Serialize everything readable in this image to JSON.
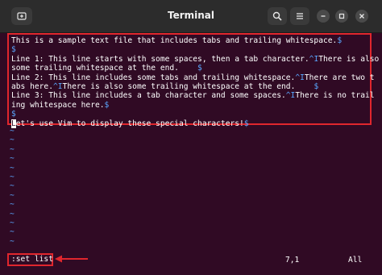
{
  "window": {
    "title": "Terminal"
  },
  "file_lines": [
    [
      {
        "t": "This is a sample text file that includes tabs and trailing whitespace."
      },
      {
        "t": "$",
        "c": "eol"
      }
    ],
    [
      {
        "t": "$",
        "c": "eol"
      }
    ],
    [
      {
        "t": "Line 1: This line starts with some spaces, then a tab character."
      },
      {
        "t": "^I",
        "c": "ctrl"
      },
      {
        "t": "There is also"
      }
    ],
    [
      {
        "t": "some trailing whitespace at the end.    "
      },
      {
        "t": "$",
        "c": "eol"
      }
    ],
    [
      {
        "t": "Line 2: This line includes some tabs and trailing whitespace."
      },
      {
        "t": "^I",
        "c": "ctrl"
      },
      {
        "t": "There are two t"
      }
    ],
    [
      {
        "t": "abs here."
      },
      {
        "t": "^I",
        "c": "ctrl"
      },
      {
        "t": "There is also some trailing whitespace at the end.    "
      },
      {
        "t": "$",
        "c": "eol"
      }
    ],
    [
      {
        "t": "Line 3: This line includes a tab character and some spaces."
      },
      {
        "t": "^I",
        "c": "ctrl"
      },
      {
        "t": "There is no trail"
      }
    ],
    [
      {
        "t": "ing whitespace here."
      },
      {
        "t": "$",
        "c": "eol"
      }
    ],
    [
      {
        "t": "$",
        "c": "eol"
      }
    ],
    [
      {
        "t": "L",
        "c": "cursor"
      },
      {
        "t": "et's use Vim to display these special characters!"
      },
      {
        "t": "$",
        "c": "eol"
      }
    ]
  ],
  "tilde_count": 13,
  "tilde_char": "~",
  "status": {
    "command": ":set list",
    "position": "7,1",
    "scroll": "All"
  },
  "colors": {
    "terminal_bg": "#300a24",
    "highlight": "#e0262d",
    "special_chars": "#5aa7ff"
  },
  "icons": {
    "new_tab": "new-tab-icon",
    "search": "search-icon",
    "menu": "hamburger-menu-icon",
    "minimize": "minimize-icon",
    "maximize": "maximize-icon",
    "close": "close-icon",
    "arrow": "left-arrow-icon"
  }
}
